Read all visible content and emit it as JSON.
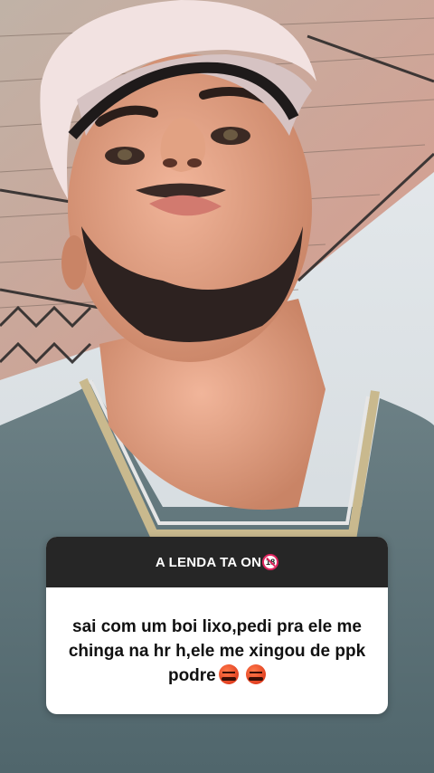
{
  "story": {
    "photo_description_icon": "selfie-photo",
    "question_sticker": {
      "title": "A LENDA TA ON",
      "title_badge_icon": "no-under-18-icon",
      "answer": "sai com um boi lixo,pedi pra ele me chinga na hr h,ele me xingou de ppk podre",
      "answer_emojis": [
        "angry-face-icon",
        "angry-face-icon"
      ]
    }
  },
  "colors": {
    "header_bg": "#262626",
    "card_bg": "#ffffff",
    "badge_red": "#e0245e"
  }
}
